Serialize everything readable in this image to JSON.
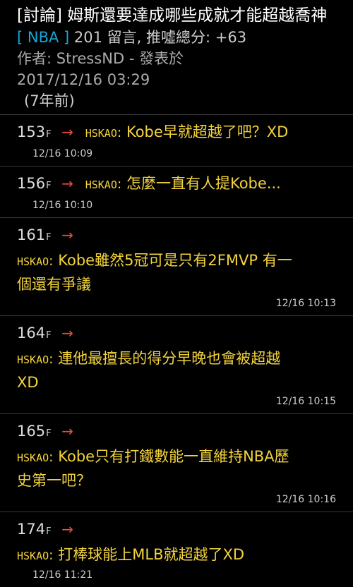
{
  "post": {
    "title": "[討論] 姆斯還要達成哪些成就才能超越喬神",
    "board": "[ NBA ]",
    "stats": "201 留言, 推噓總分: +63",
    "author_line": "作者: StressND - 發表於",
    "datetime": "2017/12/16 03:29",
    "relative": "(7年前)"
  },
  "comments": [
    {
      "floor": "153",
      "floor_suffix": "F",
      "arrow": "→",
      "user": "HSKAO",
      "colon": ":",
      "text": "Kobe早就超越了吧？XD",
      "time": "12/16 10:09"
    },
    {
      "floor": "156",
      "floor_suffix": "F",
      "arrow": "→",
      "user": "HSKAO",
      "colon": ":",
      "text": "怎麼一直有人提Kobe...",
      "time": "12/16 10:10"
    },
    {
      "floor": "161",
      "floor_suffix": "F",
      "arrow": "→",
      "user": "HSKAO",
      "colon": ":",
      "text_line1": "Kobe雖然5冠可是只有2FMVP 有一",
      "text_line2": "個還有爭議",
      "time": "12/16 10:13"
    },
    {
      "floor": "164",
      "floor_suffix": "F",
      "arrow": "→",
      "user": "HSKAO",
      "colon": ":",
      "text_line1": "連他最擅長的得分早晚也會被超越",
      "text_line2": "XD",
      "time": "12/16 10:15"
    },
    {
      "floor": "165",
      "floor_suffix": "F",
      "arrow": "→",
      "user": "HSKAO",
      "colon": ":",
      "text_line1": "Kobe只有打鐵數能一直維持NBA歷",
      "text_line2": "史第一吧？",
      "time": "12/16 10:16"
    },
    {
      "floor": "174",
      "floor_suffix": "F",
      "arrow": "→",
      "user": "HSKAO",
      "colon": ":",
      "text": "打棒球能上MLB就超越了XD",
      "time": "12/16 11:21"
    }
  ]
}
